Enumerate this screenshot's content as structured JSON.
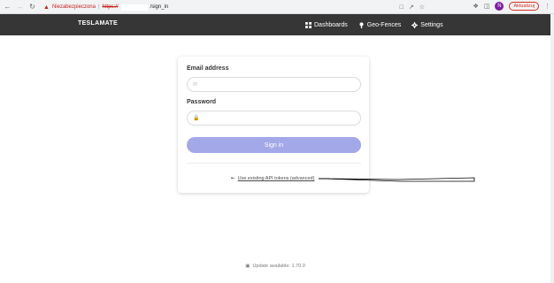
{
  "browser": {
    "insecure_label": "Niezabezpieczona",
    "separator": "|",
    "scheme": "https://",
    "path": "/sign_in",
    "profile_initial": "N",
    "update_label": "Aktualizuj"
  },
  "navbar": {
    "brand": "TESLAMATE",
    "items": [
      {
        "label": "Dashboards",
        "icon": "dashboard-icon"
      },
      {
        "label": "Geo-Fences",
        "icon": "map-marker-icon"
      },
      {
        "label": "Settings",
        "icon": "gear-icon"
      }
    ]
  },
  "login": {
    "email_label": "Email address",
    "email_value": "",
    "password_label": "Password",
    "password_value": "",
    "signin_label": "Sign in",
    "api_link": "Use existing API tokens (advanced)"
  },
  "footer": {
    "update_text": "Update available: 1.70.0"
  },
  "colors": {
    "navbar_bg": "#363636",
    "signin_bg": "#a3a8e8",
    "insecure_red": "#c5221f"
  }
}
